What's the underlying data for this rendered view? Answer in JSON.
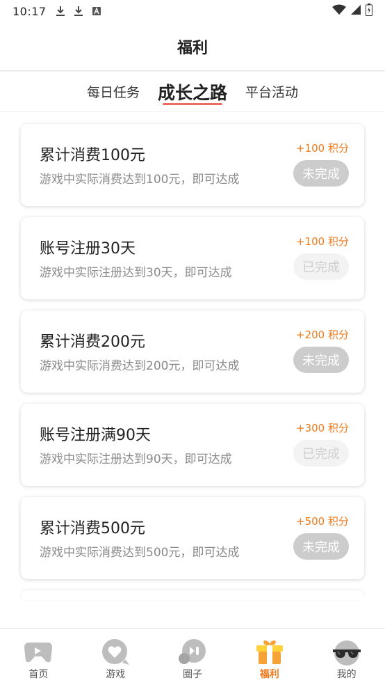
{
  "status_bar": {
    "time": "10:17",
    "left_icons": [
      "download-icon",
      "download-icon",
      "a-badge-icon"
    ],
    "right_icons": [
      "wifi-icon",
      "signal-icon",
      "battery-icon"
    ]
  },
  "header": {
    "title": "福利"
  },
  "tabs": [
    {
      "label": "每日任务",
      "active": false
    },
    {
      "label": "成长之路",
      "active": true
    },
    {
      "label": "平台活动",
      "active": false
    }
  ],
  "tasks": [
    {
      "title": "累计消费100元",
      "desc": "游戏中实际消费达到100元，即可达成",
      "points": "+100 积分",
      "status": "未完成",
      "state": "incomplete"
    },
    {
      "title": "账号注册30天",
      "desc": "游戏中实际注册达到30天，即可达成",
      "points": "+100 积分",
      "status": "已完成",
      "state": "done"
    },
    {
      "title": "累计消费200元",
      "desc": "游戏中实际消费达到200元，即可达成",
      "points": "+200 积分",
      "status": "未完成",
      "state": "incomplete"
    },
    {
      "title": "账号注册满90天",
      "desc": "游戏中实际注册达到90天，即可达成",
      "points": "+300 积分",
      "status": "已完成",
      "state": "done"
    },
    {
      "title": "累计消费500元",
      "desc": "游戏中实际消费达到500元，即可达成",
      "points": "+500 积分",
      "status": "未完成",
      "state": "incomplete"
    }
  ],
  "bottom_nav": [
    {
      "label": "首页",
      "icon": "gamepad-icon",
      "active": false
    },
    {
      "label": "游戏",
      "icon": "heart-chat-icon",
      "active": false
    },
    {
      "label": "圈子",
      "icon": "community-chat-icon",
      "active": false
    },
    {
      "label": "福利",
      "icon": "gift-icon",
      "active": true
    },
    {
      "label": "我的",
      "icon": "sunglasses-face-icon",
      "active": false
    }
  ],
  "colors": {
    "accent": "#f07a1a",
    "tab_underline": "#ee6b60",
    "button_incomplete": "#cccccc",
    "button_done": "#f3f3f3"
  }
}
